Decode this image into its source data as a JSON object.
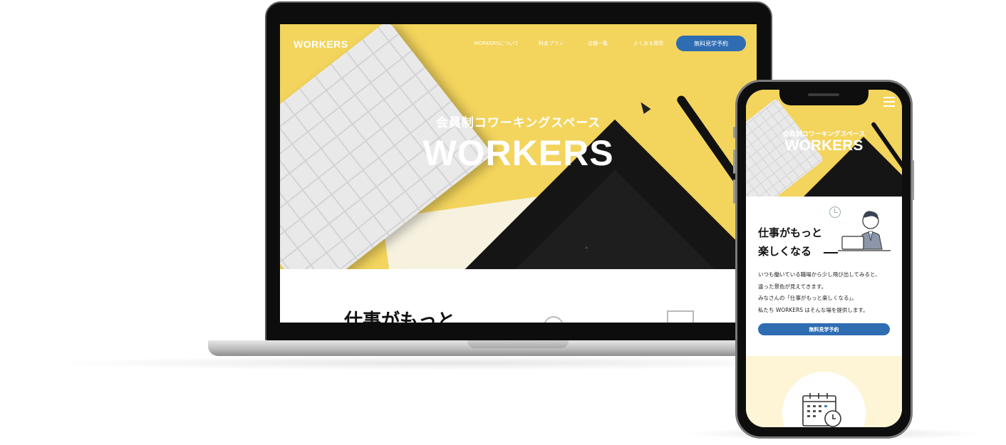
{
  "laptop": {
    "nav": {
      "logo": "WORKERS",
      "items": [
        "WORKERSについて",
        "料金プラン",
        "店舗一覧",
        "よくある質問"
      ],
      "cta": "無料見学予約"
    },
    "hero": {
      "subtitle": "会員制コワーキングスペース",
      "title": "WORKERS"
    },
    "content": {
      "heading": "仕事がもっと"
    }
  },
  "phone": {
    "hero": {
      "subtitle": "会員制コワーキングスペース",
      "title": "WORKERS"
    },
    "about": {
      "heading_line1": "仕事がもっと",
      "heading_line2": "楽しくなる",
      "body": [
        "いつも働いている職場から少し飛び出してみると、",
        "違った景色が見えてきます。",
        "みなさんの「仕事がもっと楽しくなる」。",
        "私たち WORKERS はそんな場を提供します。"
      ],
      "cta": "無料見学予約"
    }
  },
  "colors": {
    "hero_yellow": "#f3d45c",
    "cta_blue": "#2f6db3",
    "feature_bg": "#fdf5d6"
  },
  "icons": [
    "menu-icon",
    "clock-icon",
    "calendar-icon",
    "scroll-arrow-icon"
  ]
}
